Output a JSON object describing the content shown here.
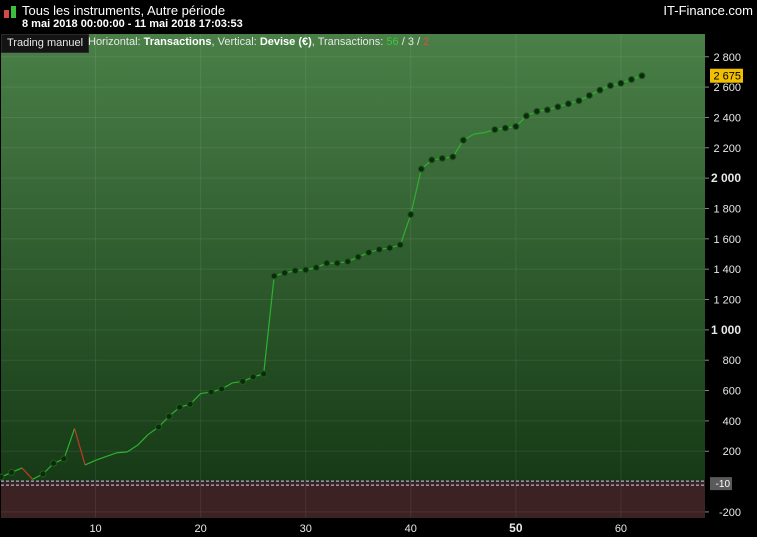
{
  "window": {
    "title": "Tous les instruments, Autre période",
    "date_range": "8 mai 2018 00:00:00 - 11 mai 2018 17:03:53",
    "brand": "IT-Finance.com"
  },
  "toolbar": {
    "mode_button": "Trading manuel",
    "horizontal_label": "Horizontal:",
    "horizontal_value": "Transactions",
    "vertical_label": ", Vertical:",
    "vertical_value": "Devise (€)",
    "transactions_label": ", Transactions:",
    "transactions_total": "56",
    "separator": " / ",
    "transactions_mid": "3",
    "transactions_red": "2"
  },
  "colors": {
    "positive_line": "#2fb02f",
    "negative_line": "#c0392b",
    "bg_top": "#4a8048",
    "bg_bottom": "#163a16",
    "negative_zone": "#3c2222",
    "last_value_badge": "#f0c000"
  },
  "chart_data": {
    "type": "line",
    "xlabel": "",
    "ylabel": "",
    "xlim": [
      1,
      68
    ],
    "ylim": [
      -240,
      2950
    ],
    "x_ticks": [
      10,
      20,
      30,
      40,
      50,
      60
    ],
    "x_bold_ticks": [
      50
    ],
    "y_ticks": [
      {
        "value": 2800,
        "label": "2 800"
      },
      {
        "value": 2600,
        "label": "2 600"
      },
      {
        "value": 2400,
        "label": "2 400"
      },
      {
        "value": 2200,
        "label": "2 200"
      },
      {
        "value": 2000,
        "label": "2 000",
        "bold": true
      },
      {
        "value": 1800,
        "label": "1 800"
      },
      {
        "value": 1600,
        "label": "1 600"
      },
      {
        "value": 1400,
        "label": "1 400"
      },
      {
        "value": 1200,
        "label": "1 200"
      },
      {
        "value": 1000,
        "label": "1 000",
        "bold": true
      },
      {
        "value": 800,
        "label": "800"
      },
      {
        "value": 600,
        "label": "600"
      },
      {
        "value": 400,
        "label": "400"
      },
      {
        "value": 200,
        "label": "200"
      },
      {
        "value": -200,
        "label": "-200"
      }
    ],
    "last_value": {
      "value": 2675,
      "label": "2 675"
    },
    "floor_marker": {
      "value": -10,
      "label": "-10"
    },
    "grid": true,
    "series": [
      {
        "values": [
          [
            1,
            30
          ],
          [
            2,
            60
          ],
          [
            3,
            90
          ],
          [
            4,
            15
          ],
          [
            5,
            50
          ],
          [
            6,
            120
          ],
          [
            7,
            150
          ],
          [
            8,
            350
          ],
          [
            9,
            110
          ],
          [
            10,
            140
          ],
          [
            11,
            165
          ],
          [
            12,
            190
          ],
          [
            13,
            195
          ],
          [
            14,
            240
          ],
          [
            15,
            310
          ],
          [
            16,
            360
          ],
          [
            17,
            430
          ],
          [
            18,
            490
          ],
          [
            19,
            510
          ],
          [
            20,
            580
          ],
          [
            21,
            590
          ],
          [
            22,
            610
          ],
          [
            23,
            650
          ],
          [
            24,
            660
          ],
          [
            25,
            690
          ],
          [
            26,
            710
          ],
          [
            27,
            1355
          ],
          [
            28,
            1375
          ],
          [
            29,
            1390
          ],
          [
            30,
            1395
          ],
          [
            31,
            1410
          ],
          [
            32,
            1440
          ],
          [
            33,
            1440
          ],
          [
            34,
            1450
          ],
          [
            35,
            1480
          ],
          [
            36,
            1510
          ],
          [
            37,
            1530
          ],
          [
            38,
            1540
          ],
          [
            39,
            1560
          ],
          [
            40,
            1760
          ],
          [
            41,
            2060
          ],
          [
            42,
            2120
          ],
          [
            43,
            2130
          ],
          [
            44,
            2140
          ],
          [
            45,
            2250
          ],
          [
            46,
            2290
          ],
          [
            47,
            2300
          ],
          [
            48,
            2320
          ],
          [
            49,
            2330
          ],
          [
            50,
            2340
          ],
          [
            51,
            2410
          ],
          [
            52,
            2440
          ],
          [
            53,
            2450
          ],
          [
            54,
            2470
          ],
          [
            55,
            2490
          ],
          [
            56,
            2510
          ],
          [
            57,
            2545
          ],
          [
            58,
            2580
          ],
          [
            59,
            2610
          ],
          [
            60,
            2625
          ],
          [
            61,
            2650
          ],
          [
            62,
            2675
          ]
        ],
        "markers_at_x": [
          1,
          2,
          5,
          6,
          7,
          16,
          17,
          18,
          19,
          21,
          22,
          24,
          25,
          26,
          27,
          28,
          29,
          30,
          31,
          32,
          33,
          34,
          35,
          36,
          37,
          38,
          39,
          40,
          41,
          42,
          43,
          44,
          45,
          48,
          49,
          50,
          51,
          52,
          53,
          54,
          55,
          56,
          57,
          58,
          59,
          60,
          61,
          62
        ]
      }
    ]
  }
}
